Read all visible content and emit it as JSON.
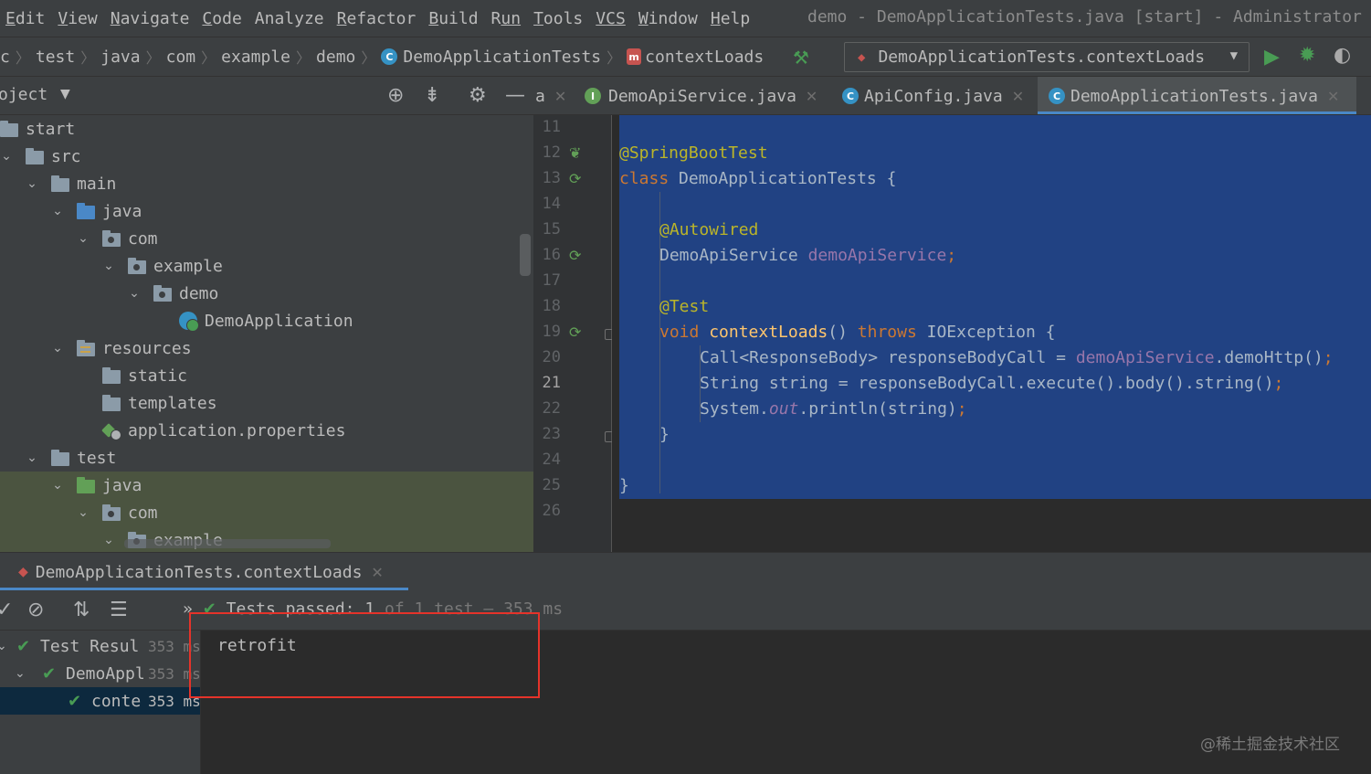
{
  "menu": [
    {
      "label": "Edit",
      "u": "E",
      "rest": "dit"
    },
    {
      "label": "View",
      "u": "V",
      "rest": "iew"
    },
    {
      "label": "Navigate",
      "u": "N",
      "rest": "avigate"
    },
    {
      "label": "Code",
      "u": "C",
      "rest": "ode"
    },
    {
      "label": "Analyze",
      "u": "",
      "rest": "Analyze"
    },
    {
      "label": "Refactor",
      "u": "R",
      "rest": "efactor"
    },
    {
      "label": "Build",
      "u": "B",
      "rest": "uild"
    },
    {
      "label": "Run",
      "u": "R",
      "rest": "un"
    },
    {
      "label": "Tools",
      "u": "T",
      "rest": "ools"
    },
    {
      "label": "VCS",
      "u": "V",
      "rest": "CS"
    },
    {
      "label": "Window",
      "u": "W",
      "rest": "indow"
    },
    {
      "label": "Help",
      "u": "H",
      "rest": "elp"
    }
  ],
  "window_title": "demo - DemoApplicationTests.java [start] - Administrator",
  "breadcrumbs": [
    "c",
    "test",
    "java",
    "com",
    "example",
    "demo",
    "DemoApplicationTests",
    "contextLoads"
  ],
  "run_config": {
    "label": "DemoApplicationTests.contextLoads"
  },
  "project_panel": {
    "title": "oject"
  },
  "project_tree": [
    {
      "label": "start",
      "icon": "folder"
    },
    {
      "label": "src",
      "icon": "folder"
    },
    {
      "label": "main",
      "icon": "folder"
    },
    {
      "label": "java",
      "icon": "folder-src"
    },
    {
      "label": "com",
      "icon": "folder-pkg"
    },
    {
      "label": "example",
      "icon": "folder-pkg"
    },
    {
      "label": "demo",
      "icon": "folder-pkg"
    },
    {
      "label": "DemoApplication",
      "icon": "spring-class"
    },
    {
      "label": "resources",
      "icon": "folder-res"
    },
    {
      "label": "static",
      "icon": "folder"
    },
    {
      "label": "templates",
      "icon": "folder"
    },
    {
      "label": "application.properties",
      "icon": "properties"
    },
    {
      "label": "test",
      "icon": "folder"
    },
    {
      "label": "java",
      "icon": "folder-test"
    },
    {
      "label": "com",
      "icon": "folder-pkg"
    },
    {
      "label": "example",
      "icon": "folder-pkg"
    }
  ],
  "editor_tabs": [
    {
      "label": "a"
    },
    {
      "label": "DemoApiService.java",
      "icon": "interface"
    },
    {
      "label": "ApiConfig.java",
      "icon": "class"
    },
    {
      "label": "DemoApplicationTests.java",
      "icon": "class",
      "active": true
    }
  ],
  "line_numbers": [
    "11",
    "12",
    "13",
    "14",
    "15",
    "16",
    "17",
    "18",
    "19",
    "20",
    "21",
    "22",
    "23",
    "24",
    "25",
    "26"
  ],
  "current_line": "21",
  "code": {
    "l12": "@SpringBootTest",
    "l13_kw": "class",
    "l13_rest": " DemoApplicationTests {",
    "l15": "@Autowired",
    "l16_type": "DemoApiService ",
    "l16_field": "demoApiService",
    "l16_end": ";",
    "l18": "@Test",
    "l19_kw": "void",
    "l19_fn": "contextLoads",
    "l19_mid": "() ",
    "l19_throws": "throws",
    "l19_rest": " IOException {",
    "l20_a": "Call<ResponseBody> responseBodyCall = ",
    "l20_field": "demoApiService",
    "l20_b": ".demoHttp()",
    "l20_end": ";",
    "l21_a": "String string = responseBodyCall.execute().body().string()",
    "l21_end": ";",
    "l22_a": "System.",
    "l22_static": "out",
    "l22_b": ".println(string)",
    "l22_end": ";",
    "l23": "}",
    "l25": "}"
  },
  "run_panel": {
    "tab_label": "DemoApplicationTests.contextLoads",
    "status_more": "»",
    "status_passed": "Tests passed: 1",
    "status_rest": " of 1 test – 353 ms",
    "results": [
      {
        "label": "Test Resul",
        "time": "353 ms"
      },
      {
        "label": "DemoAppl",
        "time": "353 ms"
      },
      {
        "label": "conte",
        "time": "353 ms"
      }
    ],
    "console_output": "retrofit"
  },
  "watermark": "@稀土掘金技术社区",
  "colors": {
    "accent": "#4a88c7",
    "success": "#499c54",
    "annotation_box": "#e5332a",
    "selection": "#214283"
  }
}
